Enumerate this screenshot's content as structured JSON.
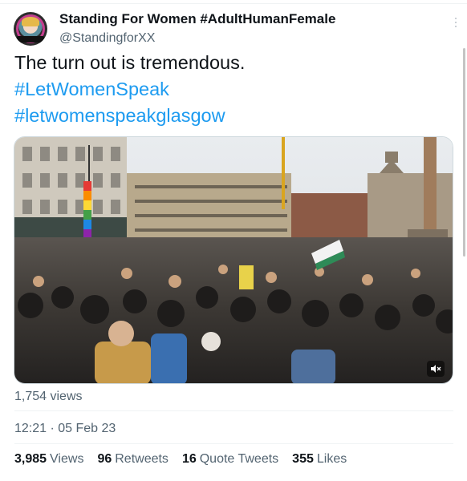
{
  "author": {
    "display_name": "Standing For Women #AdultHumanFemale",
    "handle": "@StandingforXX"
  },
  "tweet": {
    "text_line1": "The turn out is tremendous.",
    "hashtag1": "#LetWomenSpeak",
    "hashtag2": "#letwomenspeakglasgow"
  },
  "media": {
    "type": "video",
    "mute_icon": "speaker-muted-icon"
  },
  "views_text": "1,754 views",
  "timestamp": "12:21 · 05 Feb 23",
  "stats": [
    {
      "num": "3,985",
      "label": "Views"
    },
    {
      "num": "96",
      "label": "Retweets"
    },
    {
      "num": "16",
      "label": "Quote Tweets"
    },
    {
      "num": "355",
      "label": "Likes"
    }
  ],
  "colors": {
    "accent": "#1d9bf0",
    "secondary_text": "#536471",
    "primary_text": "#0f1419"
  }
}
